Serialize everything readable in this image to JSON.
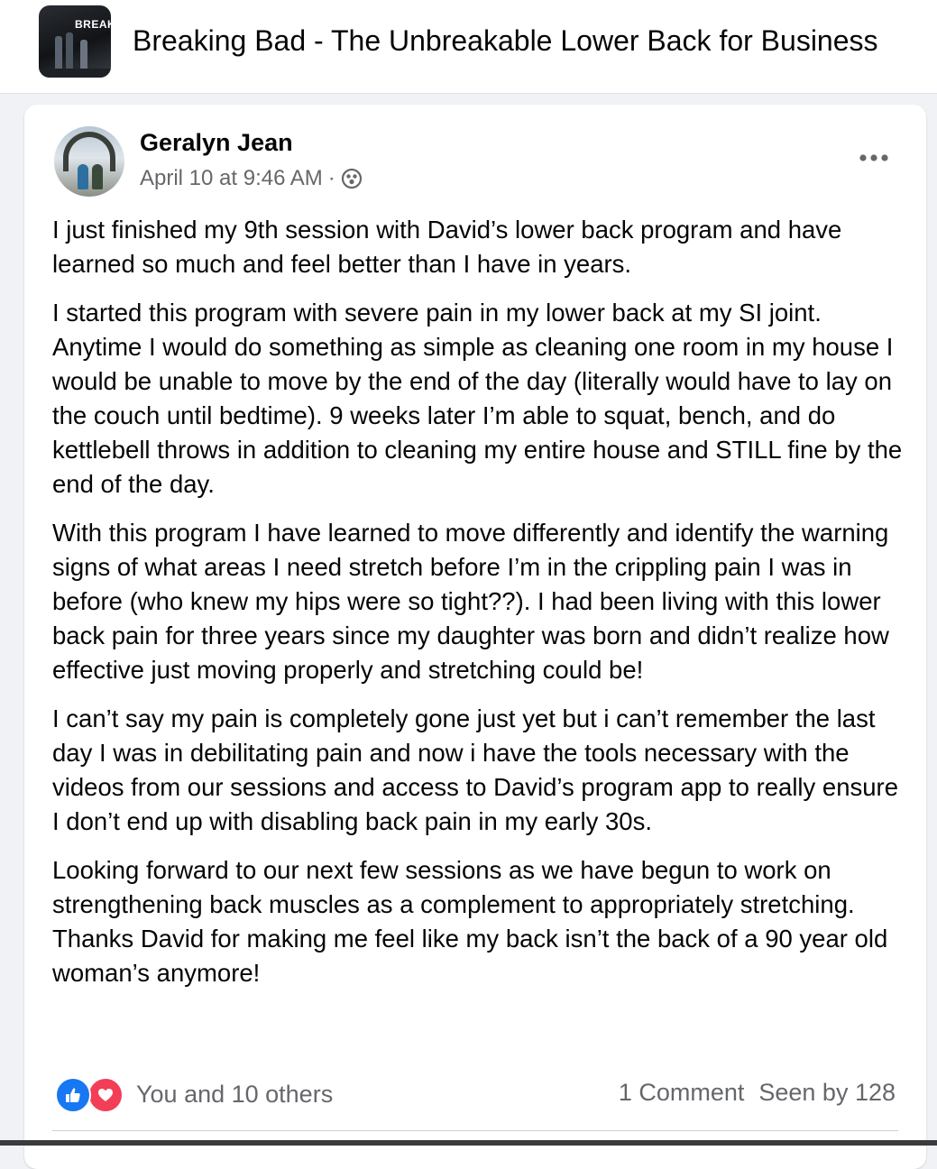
{
  "header": {
    "group_title": "Breaking Bad - The Unbreakable Lower Back for Business",
    "thumb_brand": "BREAK"
  },
  "post": {
    "author": "Geralyn Jean",
    "timestamp": "April 10 at 9:46 AM",
    "separator": "·",
    "audience_icon": "group-audience-icon",
    "paragraphs": [
      "I just finished my 9th session with David’s lower back program and have learned so much and feel better than I have in years.",
      "I started this program with severe pain in my lower back at my SI joint. Anytime I would do something as simple as cleaning one room in my house I would be unable to move by the end of the day (literally would have to lay on the couch until bedtime). 9 weeks later I’m able to squat, bench, and do kettlebell throws in addition to cleaning my entire house and STILL fine by the end of the day.",
      "With this program I have learned to move differently and identify the warning signs of what areas I need stretch before I’m in the crippling pain I was in before (who knew my hips were so tight??). I had been living with this lower back pain for three years since my daughter was born and didn’t realize how effective just moving properly and stretching could be!",
      "I can’t say my pain is completely gone just yet but i can’t remember the last day I was in debilitating pain and now i have the tools necessary with the videos from our sessions and access to David’s program app to really ensure I don’t end up with disabling back pain in my early 30s.",
      "Looking forward to our next few sessions as we have begun to work on strengthening back muscles as a complement to appropriately stretching. Thanks David for making me feel like my back isn’t the back of a 90 year old woman’s anymore!"
    ]
  },
  "footer": {
    "reactions_text": "You and 10 others",
    "comments": "1 Comment",
    "seen_by": "Seen by 128"
  },
  "colors": {
    "like": "#1877f2",
    "love": "#f33e58",
    "secondary_text": "#65676b"
  }
}
